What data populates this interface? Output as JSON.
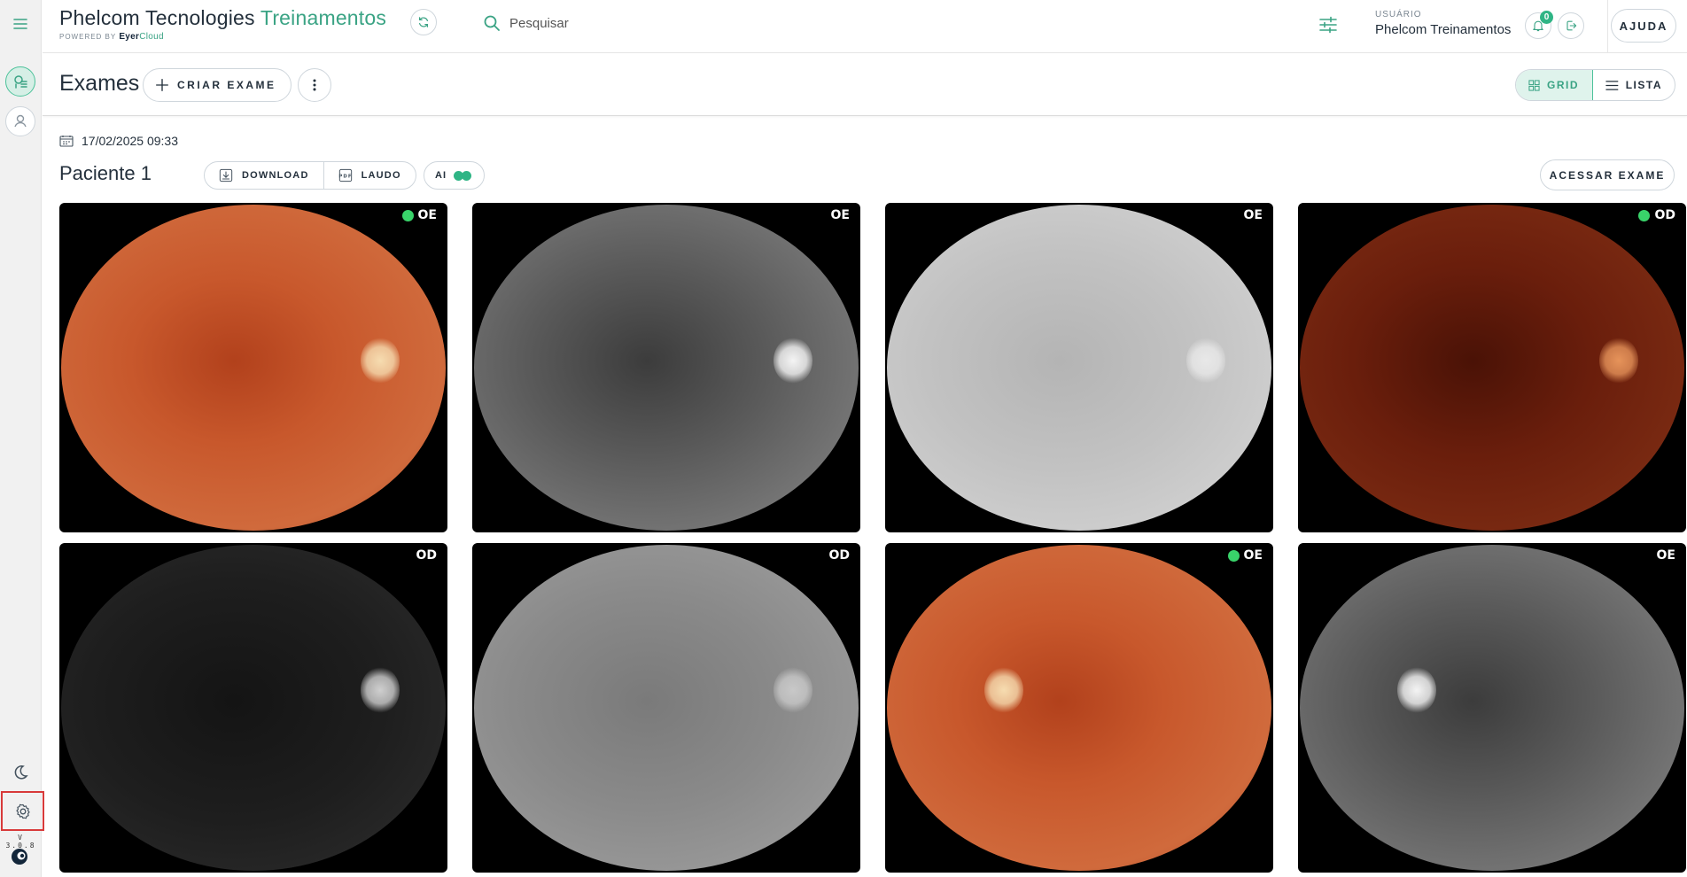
{
  "app": {
    "title_main": "Phelcom Tecnologies",
    "title_accent": "Treinamentos",
    "powered_by": "POWERED BY",
    "powered_brand_a": "Eyer",
    "powered_brand_b": "Cloud",
    "version": "V 3.0.8"
  },
  "search": {
    "placeholder": "Pesquisar"
  },
  "user": {
    "caption": "USUÁRIO",
    "name": "Phelcom Treinamentos",
    "notifications": "0"
  },
  "help": {
    "label": "AJUDA"
  },
  "toolbar": {
    "title": "Exames",
    "create_label": "CRIAR EXAME",
    "view_grid": "GRID",
    "view_list": "LISTA",
    "active_view": "grid"
  },
  "exam": {
    "date": "17/02/2025 09:33",
    "patient": "Paciente 1",
    "download_label": "DOWNLOAD",
    "report_label": "LAUDO",
    "ai_label": "AI",
    "access_label": "ACESSAR EXAME"
  },
  "images": [
    {
      "eye": "OE",
      "status": true,
      "style": "color"
    },
    {
      "eye": "OE",
      "status": false,
      "style": "redfree"
    },
    {
      "eye": "OE",
      "status": false,
      "style": "gray-light"
    },
    {
      "eye": "OD",
      "status": true,
      "style": "color-dark"
    },
    {
      "eye": "OD",
      "status": false,
      "style": "gray-dark"
    },
    {
      "eye": "OD",
      "status": false,
      "style": "gray-mid"
    },
    {
      "eye": "OE",
      "status": true,
      "style": "color"
    },
    {
      "eye": "OE",
      "status": false,
      "style": "redfree"
    }
  ],
  "colors": {
    "accent": "#3aa384",
    "badge": "#2fb585",
    "status_dot": "#39d36a",
    "highlight_border": "#d83a3a"
  }
}
